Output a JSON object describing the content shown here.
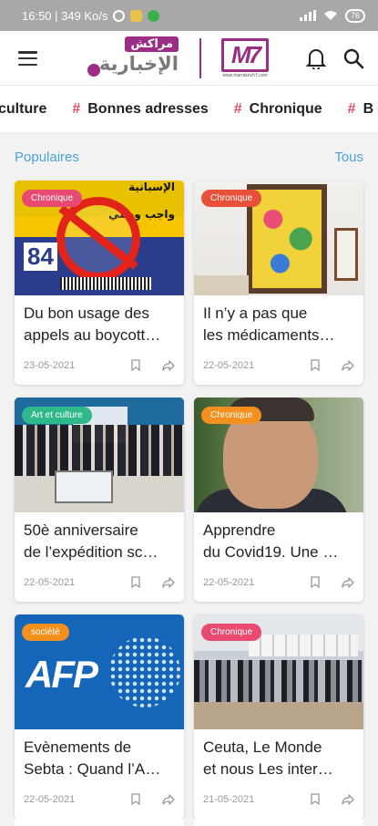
{
  "status_bar": {
    "time_speed": "16:50 | 349 Ko/s",
    "battery": "76"
  },
  "app_bar": {
    "logo_arabic_top": "مراكش",
    "logo_arabic_main": "الإخبارية",
    "logo_mark": "M7",
    "logo_mark_tagline": "www.marrakech7.com",
    "menu_icon": "hamburger-icon",
    "notification_icon": "bell-icon",
    "search_icon": "search-icon",
    "brand_color": "#9b2d84"
  },
  "tags": [
    {
      "label": "culture",
      "hash": false
    },
    {
      "label": "Bonnes adresses",
      "hash": true
    },
    {
      "label": "Chronique",
      "hash": true
    },
    {
      "label": "B",
      "hash": true
    }
  ],
  "tag_hash_symbol": "#",
  "section": {
    "title": "Populaires",
    "see_all": "Tous"
  },
  "cards": [
    {
      "badge": "Chronique",
      "badge_color": "#e84a72",
      "title_line1": "Du bon usage des",
      "title_line2": "appels au boycott…",
      "date": "23-05-2021",
      "thumb_text_num": "84",
      "thumb_text_ar1": "الإسبانية",
      "thumb_text_ar2": "واجب وطني"
    },
    {
      "badge": "Chronique",
      "badge_color": "#e8503a",
      "title_line1": "Il n’y a pas que",
      "title_line2": "les médicaments…",
      "date": "22-05-2021"
    },
    {
      "badge": "Art et culture",
      "badge_color": "#2fb98a",
      "title_line1": "50è anniversaire",
      "title_line2": "de l’expédition sc…",
      "date": "22-05-2021"
    },
    {
      "badge": "Chronique",
      "badge_color": "#f4901e",
      "title_line1": "Apprendre",
      "title_line2": "du Covid19. Une …",
      "date": "22-05-2021"
    },
    {
      "badge": "société",
      "badge_color": "#f4901e",
      "title_line1": "Evènements de",
      "title_line2": "Sebta : Quand l’A…",
      "date": "22-05-2021",
      "thumb_text_afp": "AFP"
    },
    {
      "badge": "Chronique",
      "badge_color": "#e84a72",
      "title_line1": "Ceuta, Le Monde",
      "title_line2": "et nous Les inter…",
      "date": "21-05-2021"
    }
  ],
  "card_actions": {
    "bookmark_icon": "bookmark-icon",
    "share_icon": "share-icon"
  }
}
